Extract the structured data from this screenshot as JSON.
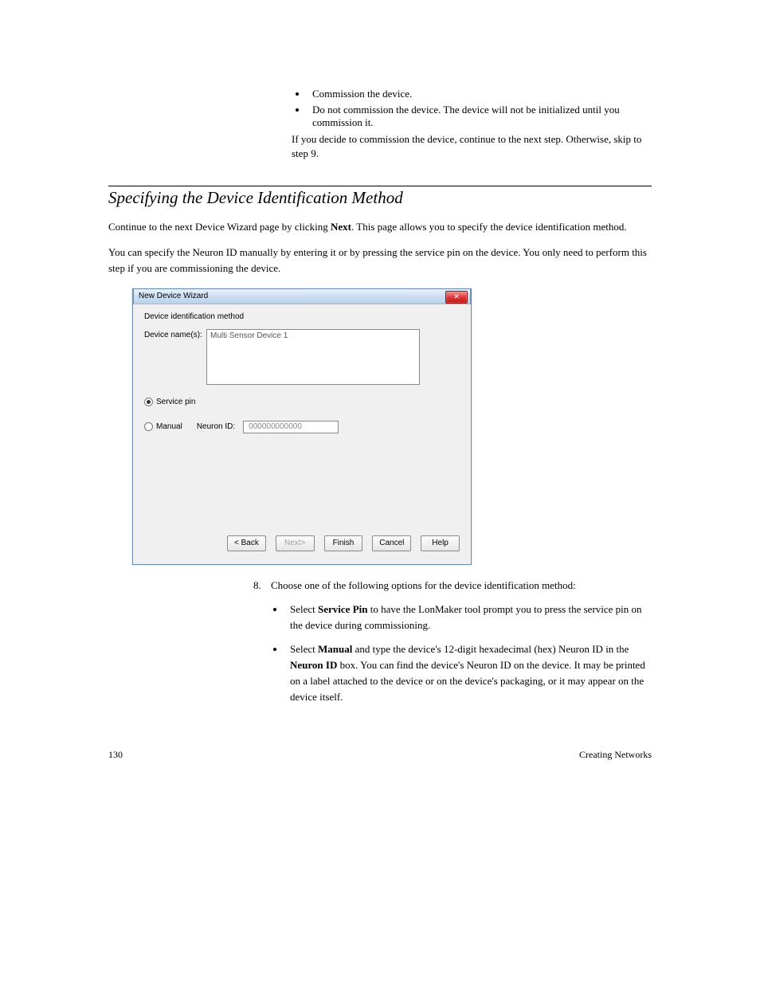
{
  "bullets_top": [
    "Commission the device.",
    "Do not commission the device. The device will not be initialized until you commission it."
  ],
  "pre_note": "If you decide to commission the device, continue to the next step. Otherwise, skip to step 9.",
  "section_title": "Specifying the Device Identification Method",
  "para1_pre": "Continue to the next Device Wizard page by clicking ",
  "para1_bold": "Next",
  "para1_post": ". This page allows you to specify the device identification method.",
  "para2": "You can specify the Neuron ID manually by entering it or by pressing the service pin on the device. You only need to perform this step if you are commissioning the device.",
  "dialog": {
    "title": "New Device Wizard",
    "heading": "Device identification method",
    "device_names_label": "Device name(s):",
    "device_name_value": "Multi Sensor Device 1",
    "radio_service_pin": "Service pin",
    "radio_manual": "Manual",
    "neuron_id_label": "Neuron ID:",
    "neuron_id_value": "000000000000",
    "close_x": "✕",
    "buttons": {
      "back": "< Back",
      "next": "Next>",
      "finish": "Finish",
      "cancel": "Cancel",
      "help": "Help"
    }
  },
  "step8": {
    "num": "8.",
    "text": "Choose one of the following options for the device identification method:",
    "sub": [
      {
        "pre": "Select ",
        "bold": "Service Pin",
        "post": " to have the LonMaker tool prompt you to press the service pin on the device during commissioning."
      },
      {
        "pre": "Select ",
        "bold": "Manual",
        "mid": " and type the device's 12-digit hexadecimal (hex) Neuron ID in the ",
        "bold2": "Neuron ID",
        "post": " box. You can find the device's Neuron ID on the device. It may be printed on a label attached to the device or on the device's packaging, or it may appear on the device itself."
      }
    ]
  },
  "footer": {
    "left": "130",
    "right": "Creating Networks"
  }
}
